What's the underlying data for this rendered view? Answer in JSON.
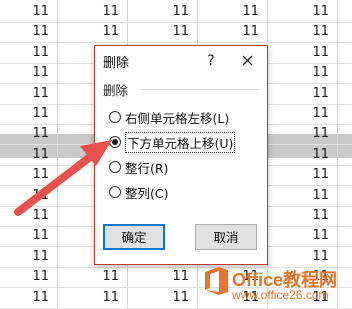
{
  "sheet": {
    "cell_value": "11",
    "columns": 5,
    "rows": 15
  },
  "dialog": {
    "title": "删除",
    "help_glyph": "?",
    "section_label": "删除",
    "options": [
      {
        "label": "右侧单元格左移(L)",
        "selected": false
      },
      {
        "label": "下方单元格上移(U)",
        "selected": true
      },
      {
        "label": "整行(R)",
        "selected": false
      },
      {
        "label": "整列(C)",
        "selected": false
      }
    ],
    "ok_label": "确定",
    "cancel_label": "取消"
  },
  "watermark": {
    "name": "Office教程网",
    "url": "www.office26.com"
  },
  "colors": {
    "arrow": "#e8524a",
    "dialog_border": "#c0392b",
    "watermark": "#e8742a",
    "selected_row": "#c9c9c9"
  },
  "icons": {
    "close": "close-icon",
    "help": "help-icon",
    "arrow": "pointer-arrow-icon",
    "logo": "office-logo-icon"
  }
}
